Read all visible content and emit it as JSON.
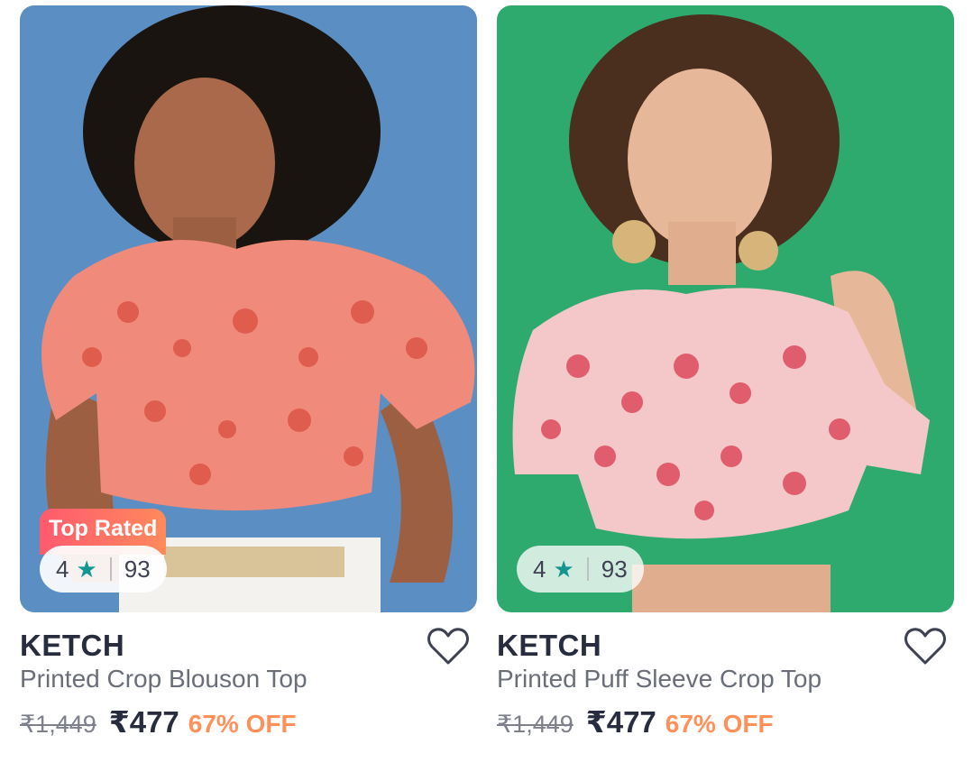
{
  "products": [
    {
      "badge": "Top Rated",
      "rating": "4",
      "rating_count": "93",
      "brand": "KETCH",
      "name": "Printed Crop Blouson Top",
      "mrp": "₹1,449",
      "price": "₹477",
      "discount": "67% OFF",
      "bg_color": "#5b8fc4"
    },
    {
      "rating": "4",
      "rating_count": "93",
      "brand": "KETCH",
      "name": "Printed Puff Sleeve Crop Top",
      "mrp": "₹1,449",
      "price": "₹477",
      "discount": "67% OFF",
      "bg_color": "#2eaa6e"
    }
  ],
  "icons": {
    "star": "star-icon",
    "wishlist": "heart-icon"
  },
  "colors": {
    "accent_discount": "#ff905a",
    "star": "#14958f",
    "badge_gradient_start": "#ff5a6e",
    "badge_gradient_end": "#ff8a5c"
  }
}
